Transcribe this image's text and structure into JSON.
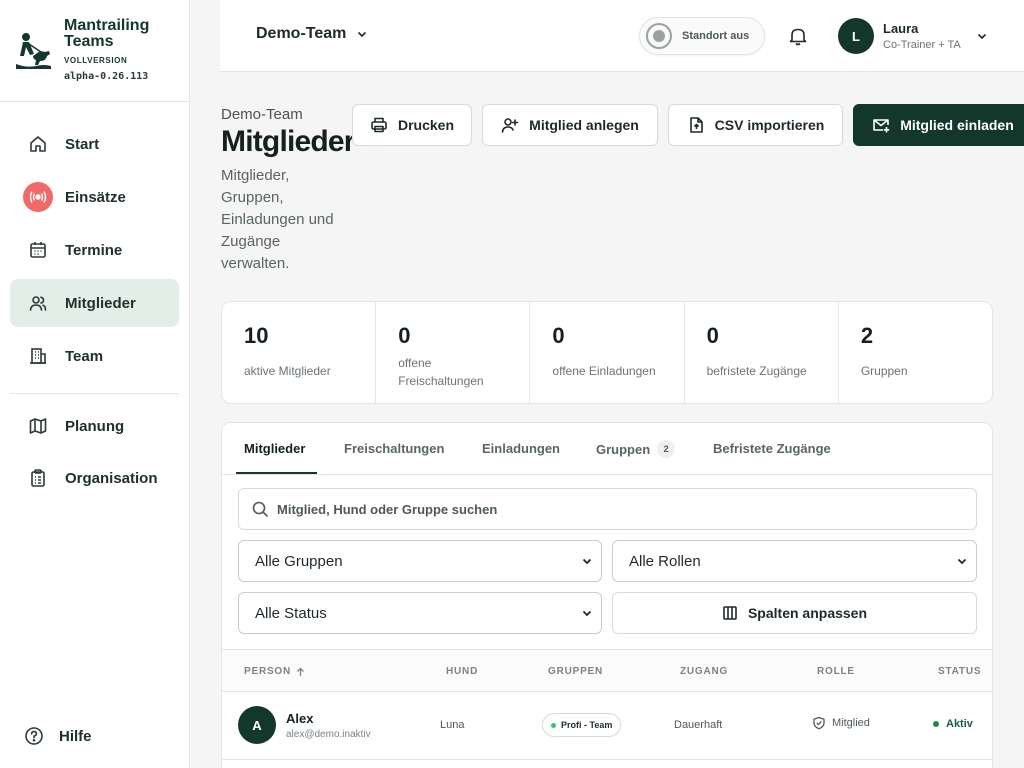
{
  "brand": {
    "name": "Mantrailing Teams",
    "plan": "VOLLVERSION",
    "version": "alpha-0.26.113"
  },
  "nav": {
    "start": "Start",
    "einsaetze": "Einsätze",
    "termine": "Termine",
    "mitglieder": "Mitglieder",
    "team": "Team",
    "planung": "Planung",
    "organisation": "Organisation",
    "hilfe": "Hilfe"
  },
  "topbar": {
    "team": "Demo-Team",
    "standort": "Standort aus",
    "user_initial": "L",
    "user_name": "Laura",
    "user_role": "Co-Trainer + TA"
  },
  "header": {
    "breadcrumb": "Demo-Team",
    "title": "Mitglieder",
    "description": "Mitglieder, Gruppen, Einladungen und Zugänge verwalten."
  },
  "actions": {
    "print": "Drucken",
    "add": "Mitglied anlegen",
    "import": "CSV importieren",
    "invite": "Mitglied einladen"
  },
  "stats": [
    {
      "value": "10",
      "label": "aktive Mitglieder"
    },
    {
      "value": "0",
      "label": "offene Freischaltungen"
    },
    {
      "value": "0",
      "label": "offene Einladungen"
    },
    {
      "value": "0",
      "label": "befristete Zugänge"
    },
    {
      "value": "2",
      "label": "Gruppen"
    }
  ],
  "tabs": {
    "mitglieder": "Mitglieder",
    "freischaltungen": "Freischaltungen",
    "einladungen": "Einladungen",
    "gruppen": "Gruppen",
    "gruppen_count": "2",
    "befristete": "Befristete Zugänge"
  },
  "filters": {
    "search_placeholder": "Mitglied, Hund oder Gruppe suchen",
    "groups": "Alle Gruppen",
    "roles": "Alle Rollen",
    "status": "Alle Status",
    "columns": "Spalten anpassen"
  },
  "table": {
    "headers": {
      "person": "PERSON",
      "hund": "HUND",
      "gruppen": "GRUPPEN",
      "zugang": "ZUGANG",
      "rolle": "ROLLE",
      "status": "STATUS"
    },
    "rows": [
      {
        "initial": "A",
        "name": "Alex",
        "email": "alex@demo.inaktiv",
        "dog": "Luna",
        "group": "Profi - Team",
        "access": "Dauerhaft",
        "role": "Mitglied",
        "status": "Aktiv"
      }
    ]
  },
  "colors": {
    "primary": "#14372c",
    "active_nav": "#e4eee9",
    "alarm": "#f16a6a",
    "status_green": "#22874f"
  }
}
